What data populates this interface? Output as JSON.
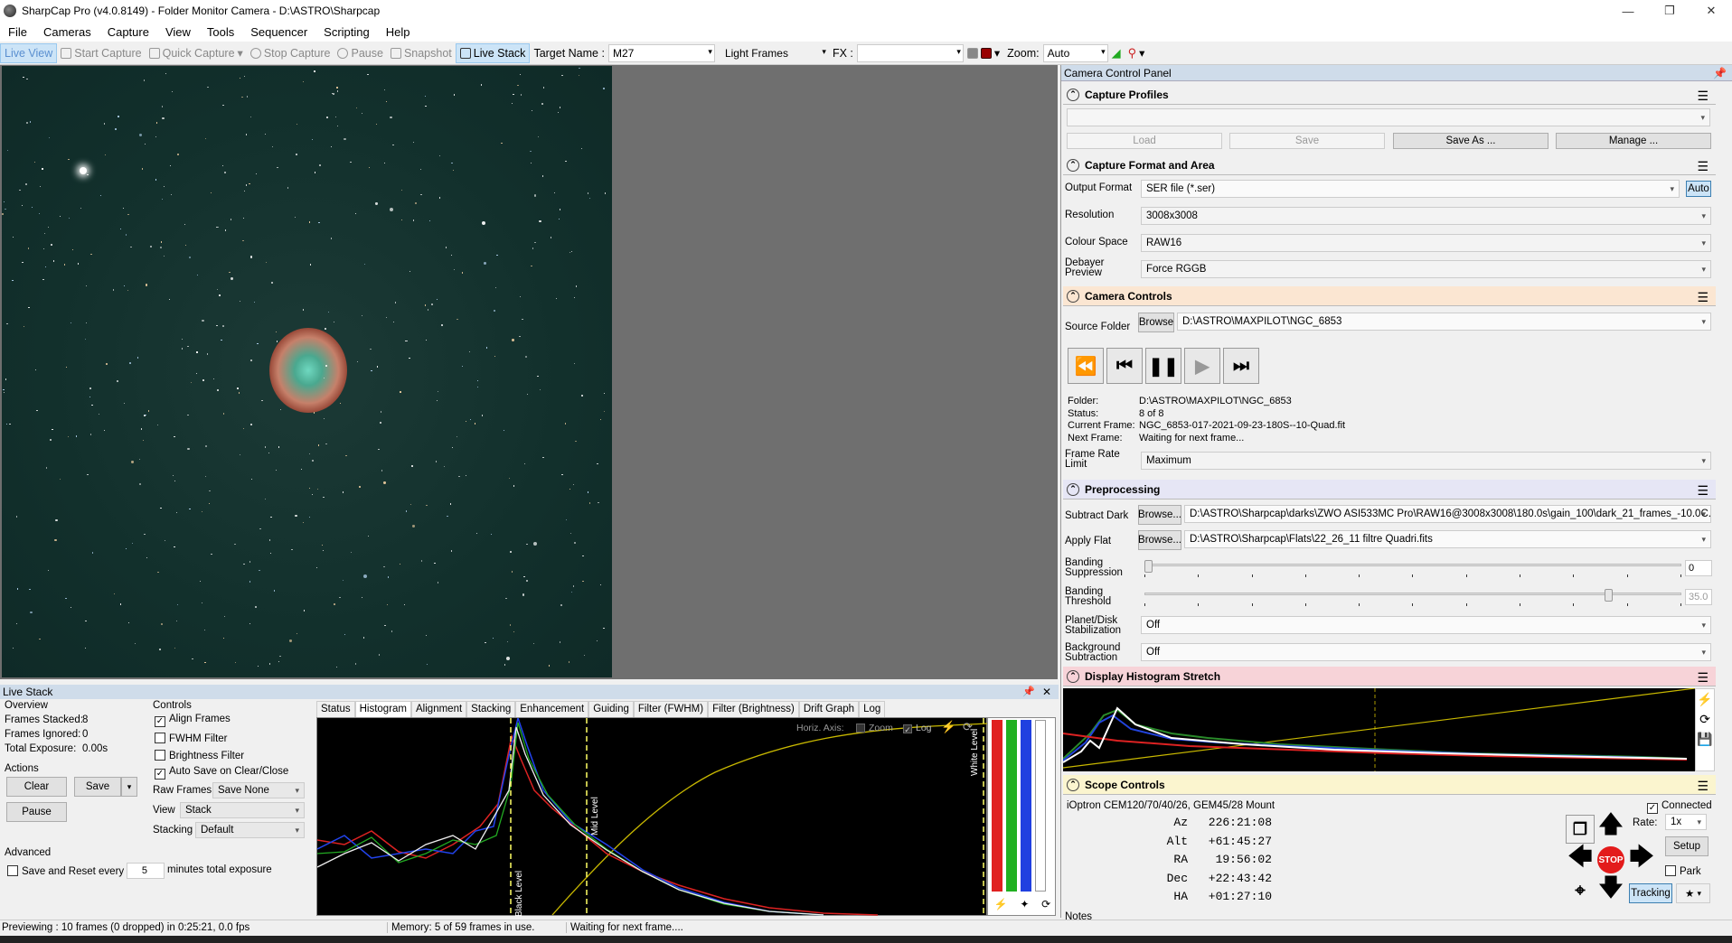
{
  "window": {
    "title": "SharpCap Pro (v4.0.8149) - Folder Monitor Camera - D:\\ASTRO\\Sharpcap"
  },
  "menu": [
    "File",
    "Cameras",
    "Capture",
    "View",
    "Tools",
    "Sequencer",
    "Scripting",
    "Help"
  ],
  "toolbar": {
    "live_view": "Live View",
    "start_capture": "Start Capture",
    "quick_capture": "Quick Capture",
    "stop_capture": "Stop Capture",
    "pause": "Pause",
    "snapshot": "Snapshot",
    "live_stack": "Live Stack",
    "target_name_label": "Target Name :",
    "target_name_value": "M27",
    "frame_type": "Light Frames",
    "fx_label": "FX :",
    "fx_value": "",
    "zoom_label": "Zoom:",
    "zoom_value": "Auto"
  },
  "ccp": {
    "title": "Camera Control Panel",
    "capture_profiles": {
      "title": "Capture Profiles",
      "selected": "",
      "load": "Load",
      "save": "Save",
      "save_as": "Save As ...",
      "manage": "Manage ..."
    },
    "capture_format": {
      "title": "Capture Format and Area",
      "output_format_label": "Output Format",
      "output_format": "SER file (*.ser)",
      "auto": "Auto",
      "resolution_label": "Resolution",
      "resolution": "3008x3008",
      "colour_space_label": "Colour Space",
      "colour_space": "RAW16",
      "debayer_label_1": "Debayer",
      "debayer_label_2": "Preview",
      "debayer": "Force RGGB"
    },
    "camera_controls": {
      "title": "Camera Controls",
      "source_folder_label": "Source Folder",
      "browse": "Browse",
      "source_folder": "D:\\ASTRO\\MAXPILOT\\NGC_6853",
      "folder_label": "Folder:",
      "folder": "D:\\ASTRO\\MAXPILOT\\NGC_6853",
      "status_label": "Status:",
      "status": "8 of 8",
      "current_frame_label": "Current Frame:",
      "current_frame": "NGC_6853-017-2021-09-23-180S--10-Quad.fit",
      "next_frame_label": "Next Frame:",
      "next_frame": "Waiting for next frame...",
      "frame_rate_label_1": "Frame Rate",
      "frame_rate_label_2": "Limit",
      "frame_rate": "Maximum"
    },
    "preprocessing": {
      "title": "Preprocessing",
      "subtract_dark_label": "Subtract Dark",
      "browse": "Browse...",
      "subtract_dark": "D:\\ASTRO\\Sharpcap\\darks\\ZWO ASI533MC Pro\\RAW16@3008x3008\\180.0s\\gain_100\\dark_21_frames_-10.0C...",
      "apply_flat_label": "Apply Flat",
      "apply_flat": "D:\\ASTRO\\Sharpcap\\Flats\\22_26_11 filtre Quadri.fits",
      "banding_supp_label_1": "Banding",
      "banding_supp_label_2": "Suppression",
      "banding_supp_value": "0",
      "banding_supp_level": 0.0,
      "banding_thresh_label_1": "Banding",
      "banding_thresh_label_2": "Threshold",
      "banding_thresh_value": "35.0",
      "banding_thresh_level": 0.87,
      "planet_label_1": "Planet/Disk",
      "planet_label_2": "Stabilization",
      "planet": "Off",
      "bg_label_1": "Background",
      "bg_label_2": "Subtraction",
      "bg": "Off"
    },
    "histogram": {
      "title": "Display Histogram Stretch"
    },
    "scope": {
      "title": "Scope Controls",
      "mount": "iOptron CEM120/70/40/26, GEM45/28 Mount",
      "connected": "Connected",
      "az_label": "Az",
      "az": "226:21:08",
      "alt_label": "Alt",
      "alt": "+61:45:27",
      "ra_label": "RA",
      "ra": "19:56:02",
      "dec_label": "Dec",
      "dec": "+22:43:42",
      "ha_label": "HA",
      "ha": "+01:27:10",
      "rate_label": "Rate:",
      "rate": "1x",
      "setup": "Setup",
      "park": "Park",
      "tracking": "Tracking",
      "stop": "STOP",
      "notes_label": "Notes"
    }
  },
  "livestack": {
    "title": "Live Stack",
    "overview_label": "Overview",
    "frames_stacked_label": "Frames Stacked:",
    "frames_stacked": "8",
    "frames_ignored_label": "Frames Ignored:",
    "frames_ignored": "0",
    "total_exposure_label": "Total Exposure:",
    "total_exposure": "0.00s",
    "actions_label": "Actions",
    "clear": "Clear",
    "save": "Save",
    "pause": "Pause",
    "advanced_label": "Advanced",
    "save_reset": "Save and Reset every",
    "save_reset_value": "5",
    "save_reset_suffix": "minutes total exposure",
    "controls_label": "Controls",
    "align_frames": "Align Frames",
    "fwhm_filter": "FWHM Filter",
    "brightness_filter": "Brightness Filter",
    "auto_save": "Auto Save on Clear/Close",
    "raw_frames_label": "Raw Frames",
    "raw_frames": "Save None",
    "view_label": "View",
    "view": "Stack",
    "stacking_label": "Stacking",
    "stacking": "Default",
    "tabs": [
      "Status",
      "Histogram",
      "Alignment",
      "Stacking",
      "Enhancement",
      "Guiding",
      "Filter (FWHM)",
      "Filter (Brightness)",
      "Drift Graph",
      "Log"
    ],
    "horiz_axis": "Horiz. Axis:",
    "zoom": "Zoom",
    "log": "Log",
    "black_level": "Black Level",
    "mid_level": "Mid Level",
    "white_level": "White Level"
  },
  "status": {
    "preview": "Previewing : 10 frames (0 dropped) in 0:25:21, 0.0 fps",
    "memory": "Memory: 5 of 59 frames in use.",
    "waiting": "Waiting for next frame...."
  },
  "colors": {
    "accent": "#cce4f7",
    "panel_header": "#cfdcea",
    "camera_controls_header": "#fbe6d2",
    "preprocessing_header": "#e6e6f5",
    "histogram_header": "#f7d3d8",
    "scope_header": "#fbf5cf"
  }
}
